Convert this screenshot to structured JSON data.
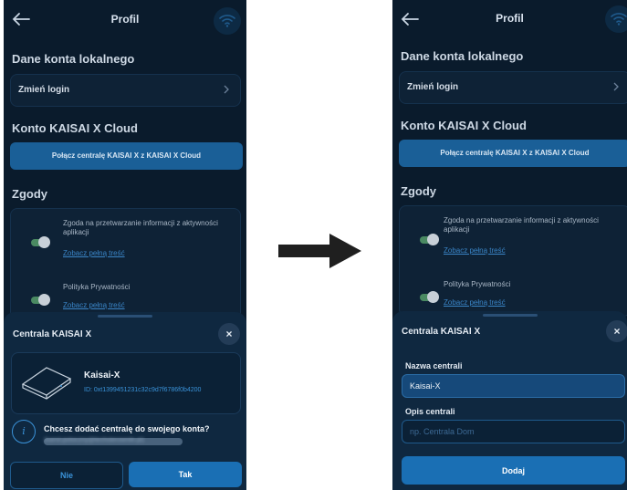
{
  "screen_title": "Profil",
  "section_local": "Dane konta lokalnego",
  "change_login": "Zmień login",
  "section_cloud": "Konto KAISAI X Cloud",
  "connect_button": "Połącz centralę KAISAI X z KAISAI X Cloud",
  "section_consents": "Zgody",
  "consent1_text": "Zgoda na przetwarzanie informacji z aktywności aplikacji",
  "consent1_link": "Zobacz pełną treść",
  "consent2_text": "Polityka Prywatności",
  "consent2_link": "Zobacz pełną treść",
  "sheet_title": "Centrala KAISAI X",
  "close_glyph": "×",
  "device_name": "Kaisai-X",
  "device_id": "ID: 0xt1399451231c32c9d7f6786f0b4200",
  "info_glyph": "i",
  "question": "Chcesz dodać centralę do swojego konta?",
  "account_email": "(kamil.potoczny@techsterowniki.pl)",
  "no_button": "Nie",
  "yes_button": "Tak",
  "name_label": "Nazwa centrali",
  "name_value": "Kaisai-X",
  "desc_label": "Opis centrali",
  "desc_placeholder": "np. Centrala Dom",
  "add_button": "Dodaj",
  "colors": {
    "background": "#0a1b2c",
    "accent": "#1a5f97",
    "link": "#3a85c7",
    "toggle_on": "#4a8a62"
  },
  "icons": [
    "back-arrow-icon",
    "wifi-icon",
    "chevron-right-icon",
    "close-icon",
    "info-icon",
    "router-device-icon",
    "arrow-right-icon"
  ]
}
